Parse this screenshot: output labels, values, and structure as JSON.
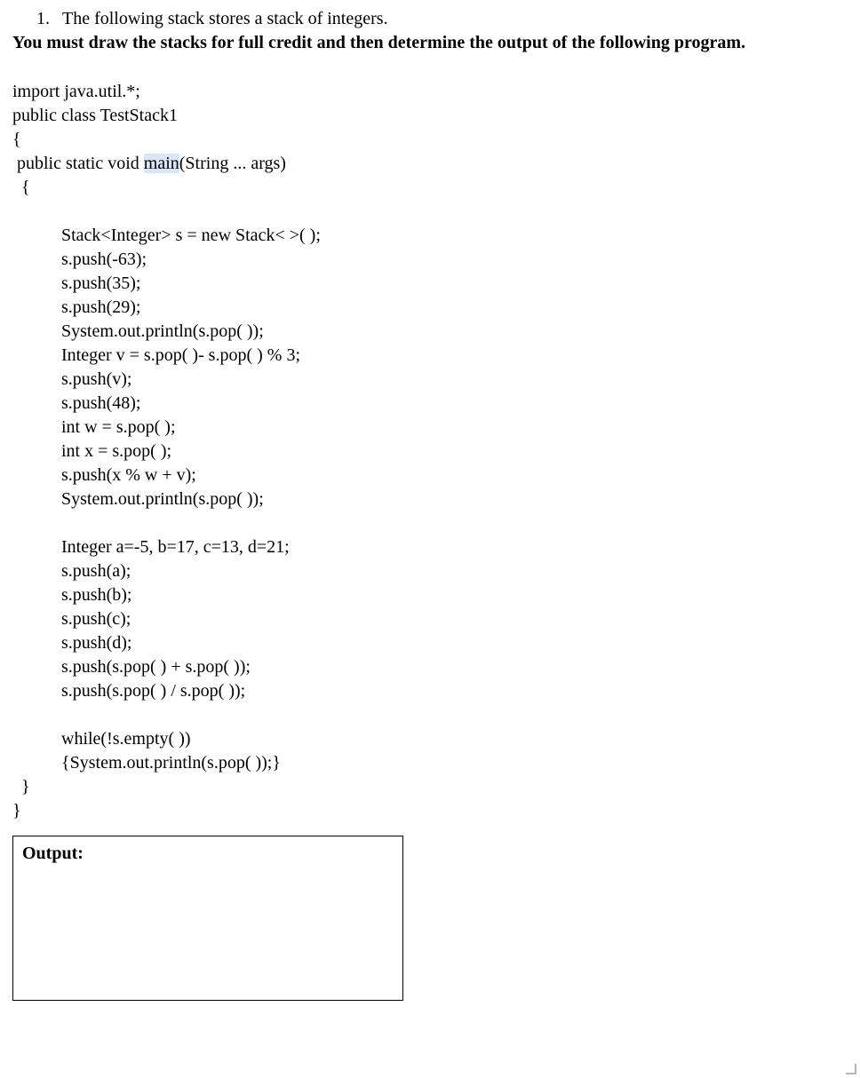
{
  "question": {
    "number": "1.",
    "intro": "The following stack stores a stack of integers.",
    "instruction": "You must draw the stacks for full credit and then determine the output of the following program."
  },
  "code": {
    "l1": "import java.util.*;",
    "l2": "public class TestStack1",
    "l3": "{",
    "l4a": " public static void ",
    "l4hl": "main",
    "l4b": "(String ... args)",
    "l5": "  {",
    "blank1": "",
    "l6": "           Stack<Integer> s = new Stack< >( );",
    "l7": "           s.push(-63);",
    "l8": "           s.push(35);",
    "l9": "           s.push(29);",
    "l10": "           System.out.println(s.pop( ));",
    "l11": "           Integer v = s.pop( )- s.pop( ) % 3;",
    "l12": "           s.push(v);",
    "l13": "           s.push(48);",
    "l14": "           int w = s.pop( );",
    "l15": "           int x = s.pop( );",
    "l16": "           s.push(x % w + v);",
    "l17": "           System.out.println(s.pop( ));",
    "blank2": "",
    "l18": "           Integer a=-5, b=17, c=13, d=21;",
    "l19": "           s.push(a);",
    "l20": "           s.push(b);",
    "l21": "           s.push(c);",
    "l22": "           s.push(d);",
    "l23": "           s.push(s.pop( ) + s.pop( ));",
    "l24": "           s.push(s.pop( ) / s.pop( ));",
    "blank3": "",
    "l25": "           while(!s.empty( ))",
    "l26": "           {System.out.println(s.pop( ));}",
    "l27": "  }",
    "l28": "}"
  },
  "output": {
    "label": "Output:"
  }
}
